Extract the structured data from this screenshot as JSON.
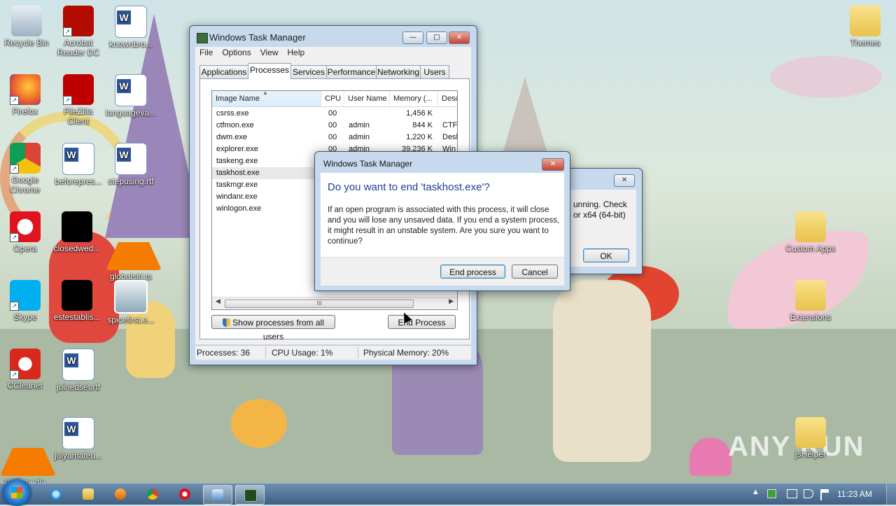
{
  "desktop": {
    "icons": [
      {
        "label": "Recycle Bin"
      },
      {
        "label": "Acrobat Reader DC"
      },
      {
        "label": "knownbro..."
      },
      {
        "label": "Firefox"
      },
      {
        "label": "FileZilla Client"
      },
      {
        "label": "languageva..."
      },
      {
        "label": "Google Chrome"
      },
      {
        "label": "beforepres..."
      },
      {
        "label": "stepusing.rtf"
      },
      {
        "label": "Opera"
      },
      {
        "label": "closedwed..."
      },
      {
        "label": "globalsid.ts"
      },
      {
        "label": "Skype"
      },
      {
        "label": "estestablis..."
      },
      {
        "label": "spicefirst.e..."
      },
      {
        "label": "CCleaner"
      },
      {
        "label": "joinedset.rtf"
      },
      {
        "label": "VLC media player"
      },
      {
        "label": "julyamateu..."
      },
      {
        "label": "Themes"
      },
      {
        "label": "Custom Apps"
      },
      {
        "label": "Extensions"
      },
      {
        "label": "jsHelper"
      }
    ],
    "watermark": "ANY RUN"
  },
  "task_manager": {
    "title": "Windows Task Manager",
    "minimize": "—",
    "maximize": "□",
    "close": "✕",
    "menu": [
      "File",
      "Options",
      "View",
      "Help"
    ],
    "tabs": [
      "Applications",
      "Processes",
      "Services",
      "Performance",
      "Networking",
      "Users"
    ],
    "active_tab": "Processes",
    "columns": [
      "Image Name",
      "CPU",
      "User Name",
      "Memory (...",
      "Desc"
    ],
    "sort_indicator": "▲",
    "rows": [
      {
        "name": "csrss.exe",
        "cpu": "00",
        "user": "",
        "mem": "1,456 K",
        "desc": ""
      },
      {
        "name": "ctfmon.exe",
        "cpu": "00",
        "user": "admin",
        "mem": "844 K",
        "desc": "CTF"
      },
      {
        "name": "dwm.exe",
        "cpu": "00",
        "user": "admin",
        "mem": "1,220 K",
        "desc": "Desl"
      },
      {
        "name": "explorer.exe",
        "cpu": "00",
        "user": "admin",
        "mem": "39,236 K",
        "desc": "Win"
      },
      {
        "name": "taskeng.exe",
        "cpu": "",
        "user": "",
        "mem": "",
        "desc": ""
      },
      {
        "name": "taskhost.exe",
        "cpu": "",
        "user": "",
        "mem": "",
        "desc": ""
      },
      {
        "name": "taskmgr.exe",
        "cpu": "",
        "user": "",
        "mem": "",
        "desc": ""
      },
      {
        "name": "windanr.exe",
        "cpu": "",
        "user": "",
        "mem": "",
        "desc": ""
      },
      {
        "name": "winlogon.exe",
        "cpu": "",
        "user": "",
        "mem": "",
        "desc": ""
      }
    ],
    "selected_row": "taskhost.exe",
    "scroll_left": "◀",
    "scroll_right": "▶",
    "scroll_grip": "III",
    "show_all_button": "Show processes from all users",
    "end_process_button": "End Process",
    "status": {
      "processes": "Processes: 36",
      "cpu": "CPU Usage: 1%",
      "memory": "Physical Memory: 20%"
    }
  },
  "background_dialog": {
    "close": "✕",
    "text_line1": "unning. Check",
    "text_line2": "or x64 (64-bit)",
    "ok_button": "OK"
  },
  "confirm_dialog": {
    "title": "Windows Task Manager",
    "close": "✕",
    "question": "Do you want to end 'taskhost.exe'?",
    "message": "If an open program is associated with this process, it will close and you will lose any unsaved data. If you end a system process, it might result in an unstable system. Are you sure you want to continue?",
    "end_button": "End process",
    "cancel_button": "Cancel"
  },
  "taskbar": {
    "pinned": [
      "internet-explorer-icon",
      "explorer-icon",
      "media-player-icon",
      "chrome-icon",
      "opera-icon",
      "remote-desktop-icon",
      "task-manager-icon"
    ],
    "tray_arrow": "▲",
    "clock": "11:23 AM"
  },
  "colors": {
    "dialog_question": "#1b3f94",
    "window_frame": "#c7daed",
    "taskbar": "#3f5f83"
  }
}
